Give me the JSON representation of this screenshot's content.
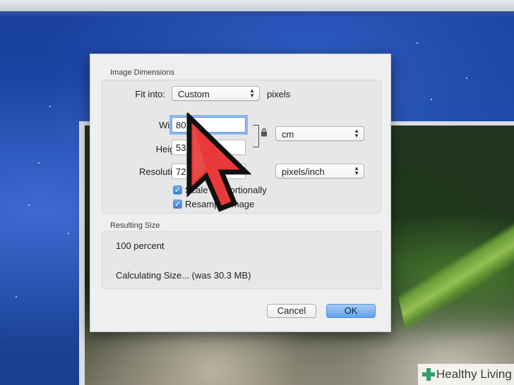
{
  "dialog": {
    "image_dimensions_title": "Image Dimensions",
    "fit_into": {
      "label": "Fit into:",
      "value": "Custom",
      "unit": "pixels"
    },
    "width": {
      "label": "Width:",
      "value": "80"
    },
    "height": {
      "label": "Height:",
      "value": "53.3"
    },
    "dimension_unit": "cm",
    "resolution": {
      "label": "Resolution:",
      "value": "72",
      "unit": "pixels/inch"
    },
    "checkboxes": [
      {
        "label": "Scale Proportionally",
        "checked": true
      },
      {
        "label": "Resample Image",
        "checked": true
      }
    ],
    "resulting_size_title": "Resulting Size",
    "percent_text": "100 percent",
    "size_text": "Calculating Size... (was 30.3 MB)",
    "buttons": {
      "cancel": "Cancel",
      "ok": "OK"
    }
  },
  "watermark": {
    "text": "Healthy Living"
  },
  "colors": {
    "cursor_fill": "#e8393b",
    "cursor_outline": "#111111",
    "focus_ring": "#8fb7ec",
    "ok_button": "#5ea0ec",
    "watermark_plus": "#2fa36b"
  }
}
